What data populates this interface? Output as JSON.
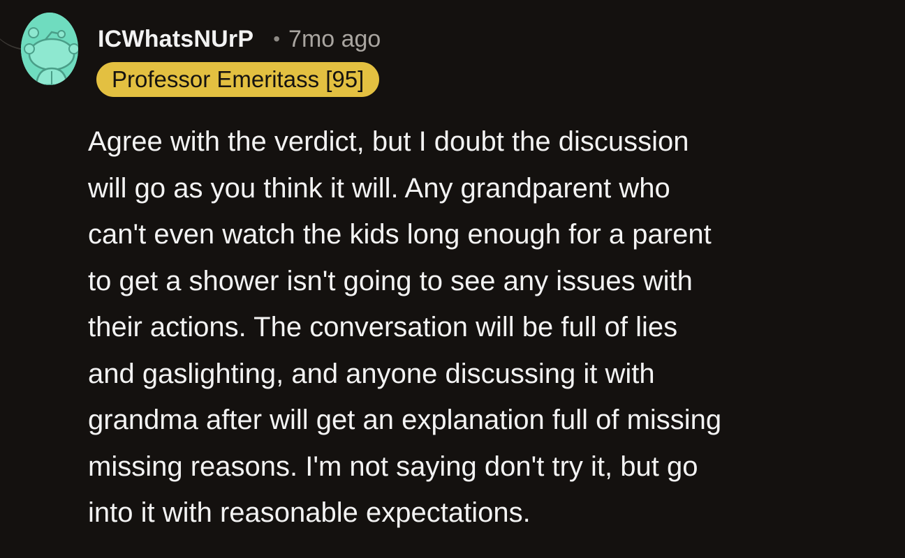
{
  "comment": {
    "username": "ICWhatsNUrP",
    "separator": "•",
    "timestamp": "7mo ago",
    "flair": "Professor Emeritass [95]",
    "body_lines": [
      "Agree with the verdict, but I doubt the discussion",
      "will go as you think it will. Any grandparent who",
      "can't even watch the kids long enough for a parent",
      "to get a shower isn't going to see any issues with",
      "their actions. The conversation will be full of lies",
      "and gaslighting, and anyone discussing it with",
      "grandma after will get an explanation full of missing",
      "missing reasons. I'm not saying don't try it, but go",
      "into it with reasonable expectations."
    ]
  },
  "colors": {
    "background": "#14110f",
    "avatar_bg": "#6fdcbf",
    "flair_bg": "#e3c041",
    "text": "#f3f3f3",
    "muted": "#a9a5a0"
  },
  "icons": {
    "avatar": "snoo-avatar-icon"
  }
}
